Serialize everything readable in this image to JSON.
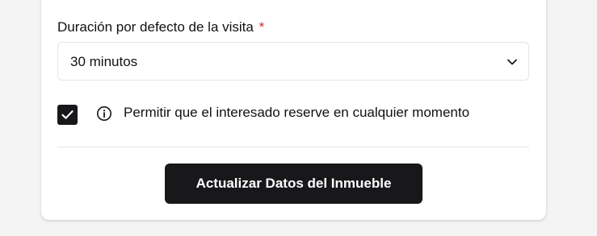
{
  "form": {
    "duration_label": "Duración por defecto de la visita",
    "required_marker": "*",
    "duration_value": "30 minutos",
    "allow_anytime_label": "Permitir que el interesado reserve en cualquier momento",
    "allow_anytime_checked": true,
    "submit_label": "Actualizar Datos del Inmueble"
  },
  "icons": {
    "select_chevron": "chevron-down-icon",
    "checkbox_mark": "checkmark-icon",
    "info": "info-icon"
  },
  "colors": {
    "primary": "#18181b",
    "required": "#dc2626",
    "border": "#e4e4e7"
  }
}
